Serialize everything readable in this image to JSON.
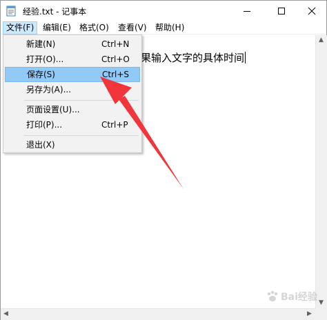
{
  "window": {
    "title": "经验.txt - 记事本"
  },
  "menubar": {
    "items": [
      {
        "label": "文件(F)"
      },
      {
        "label": "编辑(E)"
      },
      {
        "label": "格式(O)"
      },
      {
        "label": "查看(V)"
      },
      {
        "label": "帮助(H)"
      }
    ]
  },
  "editor": {
    "visible_text": "果输入文字的具体时间"
  },
  "file_menu": {
    "items": [
      {
        "label": "新建(N)",
        "shortcut": "Ctrl+N"
      },
      {
        "label": "打开(O)...",
        "shortcut": "Ctrl+O"
      },
      {
        "label": "保存(S)",
        "shortcut": "Ctrl+S",
        "highlighted": true
      },
      {
        "label": "另存为(A)...",
        "shortcut": ""
      },
      {
        "label": "页面设置(U)...",
        "shortcut": ""
      },
      {
        "label": "打印(P)...",
        "shortcut": "Ctrl+P"
      },
      {
        "label": "退出(X)",
        "shortcut": ""
      }
    ]
  },
  "watermark": {
    "text": "Bai经验"
  },
  "colors": {
    "annotation_arrow": "#f0353b",
    "menu_highlight": "#91c9f7",
    "menubar_active": "#cce8ff"
  },
  "icons": {
    "app": "notepad-icon",
    "minimize": "minimize-icon",
    "maximize": "maximize-icon",
    "close": "close-icon"
  }
}
